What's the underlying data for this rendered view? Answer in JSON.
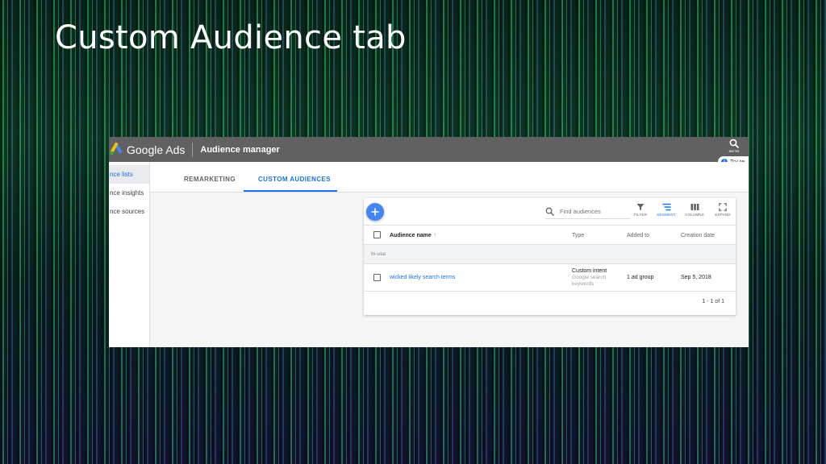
{
  "slide": {
    "title": "Custom Audience tab"
  },
  "app": {
    "brand": "Google Ads",
    "section": "Audience manager",
    "goto_label": "GO TO",
    "try_chip": "Try re",
    "colors": {
      "header": "#616161",
      "accent": "#1a73e8",
      "fab": "#4285f4"
    }
  },
  "sidebar": {
    "items": [
      {
        "label": "nce lists",
        "active": true
      },
      {
        "label": "nce insights",
        "active": false
      },
      {
        "label": "nce sources",
        "active": false
      }
    ]
  },
  "tabs": [
    {
      "label": "REMARKETING",
      "active": false
    },
    {
      "label": "CUSTOM AUDIENCES",
      "active": true
    }
  ],
  "toolbar": {
    "search_placeholder": "Find audiences",
    "filter_label": "FILTER",
    "segment_label": "SEGMENT",
    "columns_label": "COLUMNS",
    "expand_label": "EXPAND"
  },
  "table": {
    "headers": {
      "name": "Audience name",
      "type": "Type",
      "added_to": "Added to",
      "creation_date": "Creation date"
    },
    "group": "In-use",
    "rows": [
      {
        "name": "wicked likely search terms",
        "type": "Custom intent",
        "type_detail_1": "Google search",
        "type_detail_2": "keywords",
        "added_to": "1 ad group",
        "creation_date": "Sep 5, 2018"
      }
    ],
    "pagination": "1 - 1 of 1"
  }
}
